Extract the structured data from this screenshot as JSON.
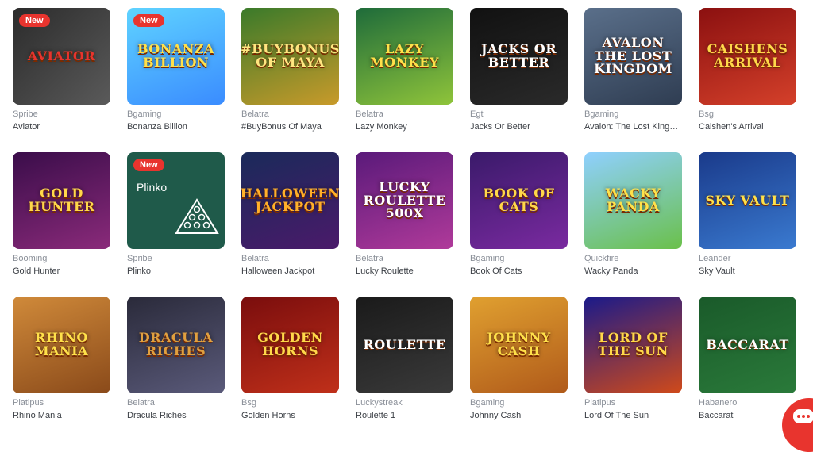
{
  "badge_new": "New",
  "games": [
    {
      "provider": "Spribe",
      "name": "Aviator",
      "art": "Aviator",
      "bg": "linear-gradient(135deg,#2b2b2b,#5a5a5a)",
      "fg": "#e8342e",
      "badge": true
    },
    {
      "provider": "Bgaming",
      "name": "Bonanza Billion",
      "art": "Bonanza Billion",
      "bg": "linear-gradient(160deg,#5fd3ff,#3a8cff)",
      "fg": "#ffe14a",
      "badge": true
    },
    {
      "provider": "Belatra",
      "name": "#BuyBonus Of Maya",
      "art": "#buyBonus of Maya",
      "bg": "linear-gradient(160deg,#3a7a2a,#c89a2a)",
      "fg": "#ffe680",
      "badge": false
    },
    {
      "provider": "Belatra",
      "name": "Lazy Monkey",
      "art": "Lazy Monkey",
      "bg": "linear-gradient(160deg,#1e6b3a,#8fc43a)",
      "fg": "#ffe14a",
      "badge": false
    },
    {
      "provider": "Egt",
      "name": "Jacks Or Better",
      "art": "Jacks or Better",
      "bg": "linear-gradient(160deg,#111111,#2a2a2a)",
      "fg": "#ffffff",
      "badge": false
    },
    {
      "provider": "Bgaming",
      "name": "Avalon: The Lost King…",
      "art": "Avalon The Lost Kingdom",
      "bg": "linear-gradient(160deg,#5a6f8a,#2f3d52)",
      "fg": "#ffffff",
      "badge": false
    },
    {
      "provider": "Bsg",
      "name": "Caishen's Arrival",
      "art": "Caishens Arrival",
      "bg": "linear-gradient(160deg,#8b1010,#d4402a)",
      "fg": "#ffd84a",
      "badge": false
    },
    {
      "provider": "Booming",
      "name": "Gold Hunter",
      "art": "Gold Hunter",
      "bg": "linear-gradient(160deg,#3a0d4a,#8a2a7a)",
      "fg": "#ffd84a",
      "badge": false
    },
    {
      "provider": "Spribe",
      "name": "Plinko",
      "art": "Plinko",
      "bg": "#1f5a4a",
      "fg": "#ffffff",
      "badge": true
    },
    {
      "provider": "Belatra",
      "name": "Halloween Jackpot",
      "art": "Halloween Jackpot",
      "bg": "linear-gradient(160deg,#1a2a5a,#4a1a6a)",
      "fg": "#ffb02a",
      "badge": false
    },
    {
      "provider": "Belatra",
      "name": "Lucky Roulette",
      "art": "Lucky Roulette 500x",
      "bg": "linear-gradient(160deg,#5a1a7a,#b03a9a)",
      "fg": "#ffffff",
      "badge": false
    },
    {
      "provider": "Bgaming",
      "name": "Book Of Cats",
      "art": "Book of Cats",
      "bg": "linear-gradient(160deg,#3a1a6a,#7a2aa0)",
      "fg": "#ffd84a",
      "badge": false
    },
    {
      "provider": "Quickfire",
      "name": "Wacky Panda",
      "art": "Wacky Panda",
      "bg": "linear-gradient(160deg,#8fd0ff,#6ac04a)",
      "fg": "#ffe14a",
      "badge": false
    },
    {
      "provider": "Leander",
      "name": "Sky Vault",
      "art": "Sky Vault",
      "bg": "linear-gradient(160deg,#1a3a8a,#3a7ad0)",
      "fg": "#ffe14a",
      "badge": false
    },
    {
      "provider": "Platipus",
      "name": "Rhino Mania",
      "art": "Rhino Mania",
      "bg": "linear-gradient(160deg,#d08a3a,#8a4a1a)",
      "fg": "#ffe14a",
      "badge": false
    },
    {
      "provider": "Belatra",
      "name": "Dracula Riches",
      "art": "Dracula Riches",
      "bg": "linear-gradient(160deg,#2a2a3a,#5a5a7a)",
      "fg": "#e0a040",
      "badge": false
    },
    {
      "provider": "Bsg",
      "name": "Golden Horns",
      "art": "Golden Horns",
      "bg": "linear-gradient(160deg,#7a0d0d,#c0301a)",
      "fg": "#ffd84a",
      "badge": false
    },
    {
      "provider": "Luckystreak",
      "name": "Roulette 1",
      "art": "Roulette",
      "bg": "linear-gradient(160deg,#1a1a1a,#3a3a3a)",
      "fg": "#ffffff",
      "badge": false
    },
    {
      "provider": "Bgaming",
      "name": "Johnny Cash",
      "art": "Johnny Cash",
      "bg": "linear-gradient(160deg,#e0a030,#b05a1a)",
      "fg": "#ffe14a",
      "badge": false
    },
    {
      "provider": "Platipus",
      "name": "Lord Of The Sun",
      "art": "Lord of the Sun",
      "bg": "linear-gradient(160deg,#1a1a8a,#d04a1a)",
      "fg": "#ffd84a",
      "badge": false
    },
    {
      "provider": "Habanero",
      "name": "Baccarat",
      "art": "Baccarat",
      "bg": "linear-gradient(160deg,#1a5a2a,#2a7a3a)",
      "fg": "#ffffff",
      "badge": false
    }
  ],
  "chat_icon": "chat-bubble-icon",
  "colors": {
    "accent": "#e8342e",
    "provider_text": "#8a8f98",
    "name_text": "#3b3f45"
  }
}
